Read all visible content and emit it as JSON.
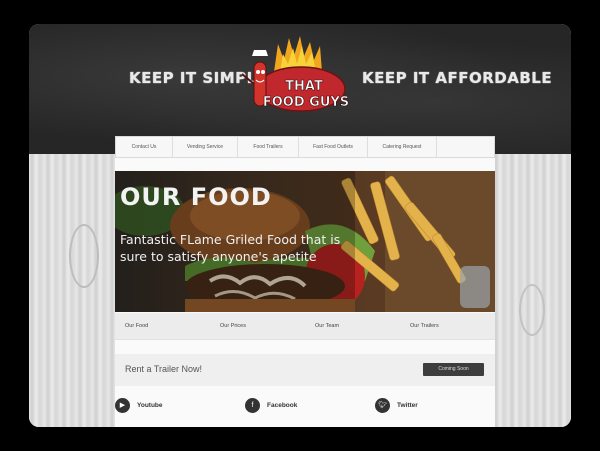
{
  "header": {
    "slogan_left": "KEEP IT SIMPLE",
    "slogan_right": "KEEP IT AFFORDABLE",
    "logo_text_line1": "THAT",
    "logo_text_line2": "FOOD GUYS"
  },
  "nav": {
    "items": [
      {
        "label": "Contact Us"
      },
      {
        "label": "Vending Service"
      },
      {
        "label": "Food Trailers"
      },
      {
        "label": "Fast Food Outlets"
      },
      {
        "label": "Catering Request"
      }
    ]
  },
  "hero": {
    "title": "OUR FOOD",
    "subtitle": "Fantastic FLame Griled Food that is sure to satisfy anyone's apetite"
  },
  "subnav": {
    "items": [
      {
        "label": "Our Food"
      },
      {
        "label": "Our Prices"
      },
      {
        "label": "Our Team"
      },
      {
        "label": "Our Trailers"
      }
    ]
  },
  "rent": {
    "text": "Rent a Trailer Now!",
    "button": "Coming Soon"
  },
  "social": {
    "youtube": "Youtube",
    "facebook": "Facebook",
    "twitter": "Twitter"
  },
  "colors": {
    "header_bg": "#262626",
    "logo_red": "#c0282d",
    "button_bg": "#3d3d3d"
  }
}
